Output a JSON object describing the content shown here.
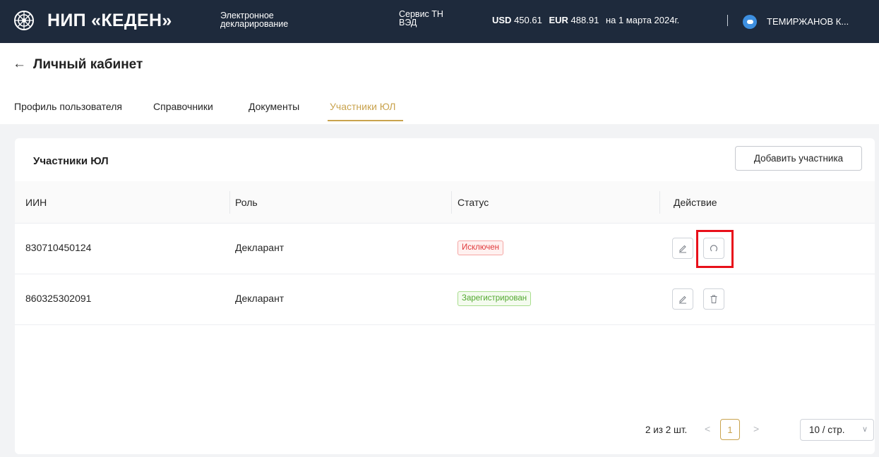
{
  "header": {
    "brand": "НИП «КЕДЕН»",
    "subtitle_line1": "Электронное",
    "subtitle_line2": "декларирование",
    "service_line1": "Сервис ТН",
    "service_line2": "ВЭД",
    "usd_label": "USD",
    "usd_value": "450.61",
    "eur_label": "EUR",
    "eur_value": "488.91",
    "rate_date": "на 1 марта 2024г.",
    "username": "ТЕМИРЖАНОВ К..."
  },
  "page": {
    "title": "Личный кабинет"
  },
  "tabs": [
    {
      "label": "Профиль пользователя",
      "active": false
    },
    {
      "label": "Справочники",
      "active": false
    },
    {
      "label": "Документы",
      "active": false
    },
    {
      "label": "Участники ЮЛ",
      "active": true
    }
  ],
  "card": {
    "title": "Участники ЮЛ",
    "add_button": "Добавить участника"
  },
  "table": {
    "columns": [
      "ИИН",
      "Роль",
      "Статус",
      "Действие"
    ],
    "rows": [
      {
        "iin": "830710450124",
        "role": "Декларант",
        "status": "Исключен",
        "status_color": "#e0393b",
        "actions": [
          "edit-icon",
          "restore-icon"
        ]
      },
      {
        "iin": "860325302091",
        "role": "Декларант",
        "status": "Зарегистрирован",
        "status_color": "#52a82f",
        "actions": [
          "edit-icon",
          "delete-icon"
        ]
      }
    ]
  },
  "pagination": {
    "total": "2 из 2 шт.",
    "current_page": "1",
    "page_size": "10 / стр."
  },
  "colors": {
    "topbar": "#1e2a3c",
    "accent": "#c9a34e",
    "highlight": "#e8101a"
  }
}
